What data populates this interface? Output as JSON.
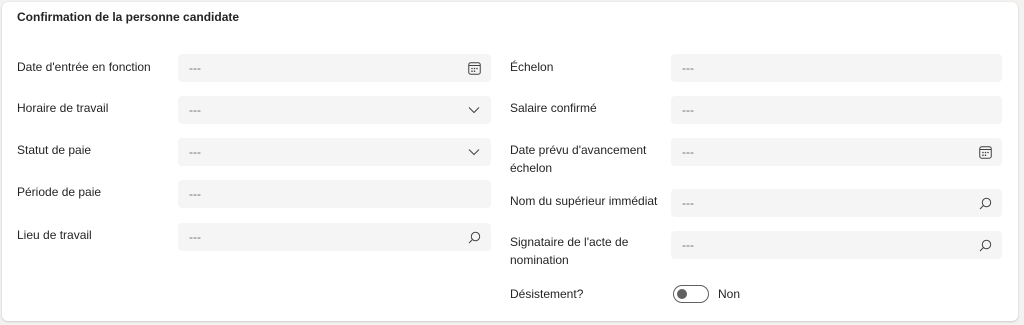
{
  "section": {
    "title": "Confirmation de la personne candidate"
  },
  "fields": {
    "date_entree": {
      "label": "Date d'entrée en fonction",
      "value": "---"
    },
    "horaire": {
      "label": "Horaire de travail",
      "value": "---"
    },
    "statut_paie": {
      "label": "Statut de paie",
      "value": "---"
    },
    "periode_paie": {
      "label": "Période de paie",
      "value": "---"
    },
    "lieu_travail": {
      "label": "Lieu de travail",
      "value": "---"
    },
    "echelon": {
      "label": "Échelon",
      "value": "---"
    },
    "salaire": {
      "label": "Salaire confirmé",
      "value": "---"
    },
    "date_avancement": {
      "label_line1": "Date prévu d'avancement",
      "label_line2": "échelon",
      "value": "---"
    },
    "superieur": {
      "label": "Nom du supérieur immédiat",
      "value": "---"
    },
    "signataire": {
      "label_line1": "Signataire de l'acte de",
      "label_line2": "nomination",
      "value": "---"
    },
    "desistement": {
      "label": "Désistement?",
      "toggle_text": "Non",
      "checked": false
    }
  },
  "icons": {
    "calendar": "calendar-icon",
    "chevron": "chevron-down-icon",
    "search": "search-icon"
  },
  "colors": {
    "field_bg": "#f5f5f5",
    "placeholder": "#707070",
    "toggle": "#616161"
  }
}
